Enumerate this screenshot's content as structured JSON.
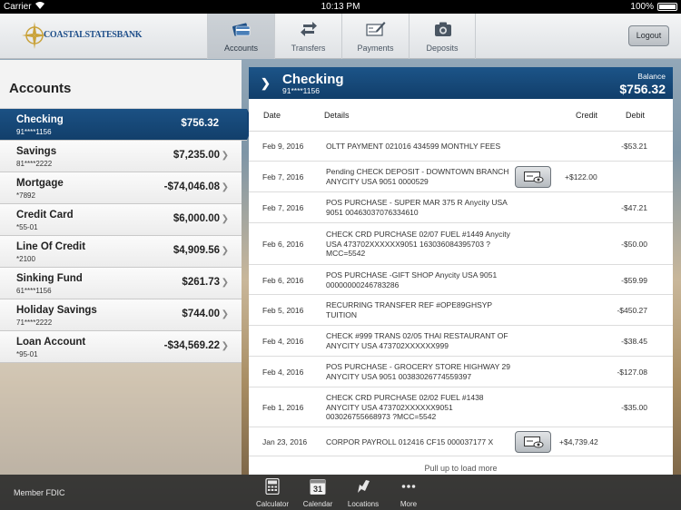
{
  "status_bar": {
    "carrier": "Carrier",
    "time": "10:13 PM",
    "battery": "100%"
  },
  "header": {
    "bank_name": "COASTALSTATESBANK",
    "tabs": [
      {
        "label": "Accounts",
        "icon": "card-icon",
        "active": true
      },
      {
        "label": "Transfers",
        "icon": "transfer-arrows-icon",
        "active": false
      },
      {
        "label": "Payments",
        "icon": "check-pen-icon",
        "active": false
      },
      {
        "label": "Deposits",
        "icon": "camera-icon",
        "active": false
      }
    ],
    "logout_label": "Logout"
  },
  "sidebar": {
    "title": "Accounts",
    "accounts": [
      {
        "name": "Checking",
        "number": "91****1156",
        "balance": "$756.32",
        "selected": true
      },
      {
        "name": "Savings",
        "number": "81****2222",
        "balance": "$7,235.00"
      },
      {
        "name": "Mortgage",
        "number": "*7892",
        "balance": "-$74,046.08"
      },
      {
        "name": "Credit Card",
        "number": "*55-01",
        "balance": "$6,000.00"
      },
      {
        "name": "Line Of Credit",
        "number": "*2100",
        "balance": "$4,909.56"
      },
      {
        "name": "Sinking Fund",
        "number": "61****1156",
        "balance": "$261.73"
      },
      {
        "name": "Holiday Savings",
        "number": "71****2222",
        "balance": "$744.00"
      },
      {
        "name": "Loan Account",
        "number": "*95-01",
        "balance": "-$34,569.22"
      }
    ]
  },
  "detail": {
    "account_name": "Checking",
    "account_number": "91****1156",
    "balance_label": "Balance",
    "balance": "$756.32",
    "columns": {
      "date": "Date",
      "details": "Details",
      "credit": "Credit",
      "debit": "Debit"
    },
    "transactions": [
      {
        "date": "Feb 9, 2016",
        "details": "OLTT PAYMENT 021016 434599 MONTHLY FEES",
        "credit": "",
        "debit": "-$53.21",
        "has_image": false
      },
      {
        "date": "Feb 7, 2016",
        "details": "Pending CHECK DEPOSIT - DOWNTOWN BRANCH ANYCITY USA 9051 0000529",
        "credit": "+$122.00",
        "debit": "",
        "has_image": true
      },
      {
        "date": "Feb 7, 2016",
        "details": "POS PURCHASE - SUPER MAR 375 R Anycity USA 9051 00463037076334610",
        "credit": "",
        "debit": "-$47.21",
        "has_image": false
      },
      {
        "date": "Feb 6, 2016",
        "details": "CHECK CRD PURCHASE 02/07 FUEL #1449 Anycity USA 473702XXXXXX9051 163036084395703 ?MCC=5542",
        "credit": "",
        "debit": "-$50.00",
        "has_image": false
      },
      {
        "date": "Feb 6, 2016",
        "details": "POS PURCHASE -GIFT SHOP Anycity USA 9051 00000000246783286",
        "credit": "",
        "debit": "-$59.99",
        "has_image": false
      },
      {
        "date": "Feb 5, 2016",
        "details": "RECURRING TRANSFER REF #OPE89GHSYP TUITION",
        "credit": "",
        "debit": "-$450.27",
        "has_image": false
      },
      {
        "date": "Feb 4, 2016",
        "details": "CHECK #999 TRANS 02/05 THAI RESTAURANT OF ANYCITY USA 473702XXXXXX999",
        "credit": "",
        "debit": "-$38.45",
        "has_image": false
      },
      {
        "date": "Feb 4, 2016",
        "details": "POS PURCHASE - GROCERY STORE HIGHWAY 29 ANYCITY USA 9051 00383026774559397",
        "credit": "",
        "debit": "-$127.08",
        "has_image": false
      },
      {
        "date": "Feb 1, 2016",
        "details": "CHECK CRD PURCHASE 02/02 FUEL #1438 ANYCITY USA 473702XXXXXX9051 003026755668973 ?MCC=5542",
        "credit": "",
        "debit": "-$35.00",
        "has_image": false
      },
      {
        "date": "Jan 23, 2016",
        "details": "CORPOR PAYROLL 012416 CF15 000037177 X",
        "credit": "+$4,739.42",
        "debit": "",
        "has_image": true
      }
    ],
    "pull_text": "Pull up to load more"
  },
  "bottom_bar": {
    "fdic": "Member FDIC",
    "tools": [
      {
        "label": "Calculator",
        "icon": "calculator-icon"
      },
      {
        "label": "Calendar",
        "icon": "calendar-icon",
        "day": "31"
      },
      {
        "label": "Locations",
        "icon": "map-pin-icon"
      },
      {
        "label": "More",
        "icon": "more-dots-icon"
      }
    ]
  }
}
